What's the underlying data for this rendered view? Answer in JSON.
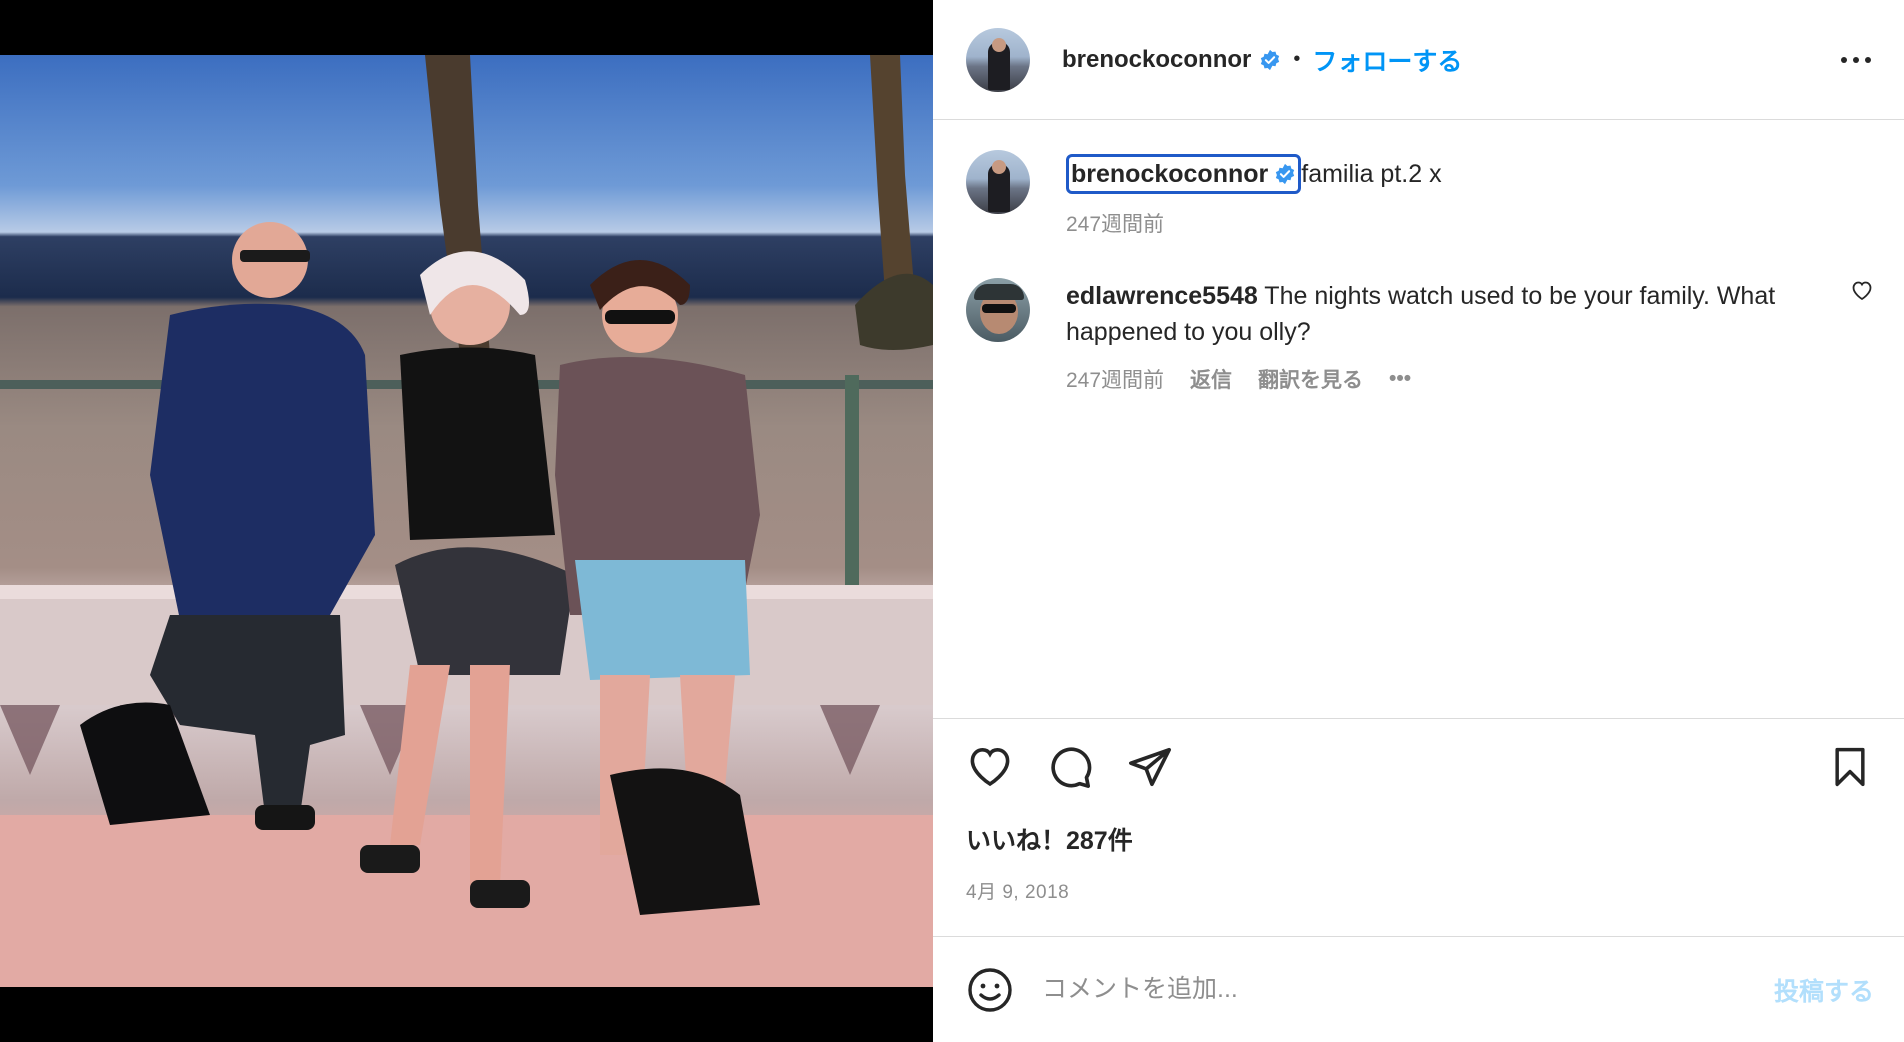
{
  "post": {
    "username": "brenockoconnor",
    "separator": "•",
    "follow_label": "フォローする",
    "more_icon": "more-horizontal-icon",
    "verified_icon": "verified-badge-icon"
  },
  "caption": {
    "username": "brenockoconnor",
    "text": "familia pt.2 x",
    "time": "247週間前"
  },
  "comments": [
    {
      "username": "edlawrence5548",
      "text": "The nights watch used to be your family. What happened to you olly?",
      "time": "247週間前",
      "reply_label": "返信",
      "translate_label": "翻訳を見る",
      "more_label": "•••"
    }
  ],
  "actions": {
    "like_icon": "heart-icon",
    "comment_icon": "comment-icon",
    "share_icon": "send-icon",
    "save_icon": "bookmark-icon",
    "likes_text": "いいね！287件",
    "date": "4月 9, 2018"
  },
  "add_comment": {
    "emoji_icon": "emoji-icon",
    "placeholder": "コメントを追加...",
    "post_label": "投稿する"
  },
  "colors": {
    "accent": "#0095f6",
    "post_disabled": "#b2dffc",
    "verified": "#3897f0",
    "highlight_box": "#1f5ac8"
  }
}
